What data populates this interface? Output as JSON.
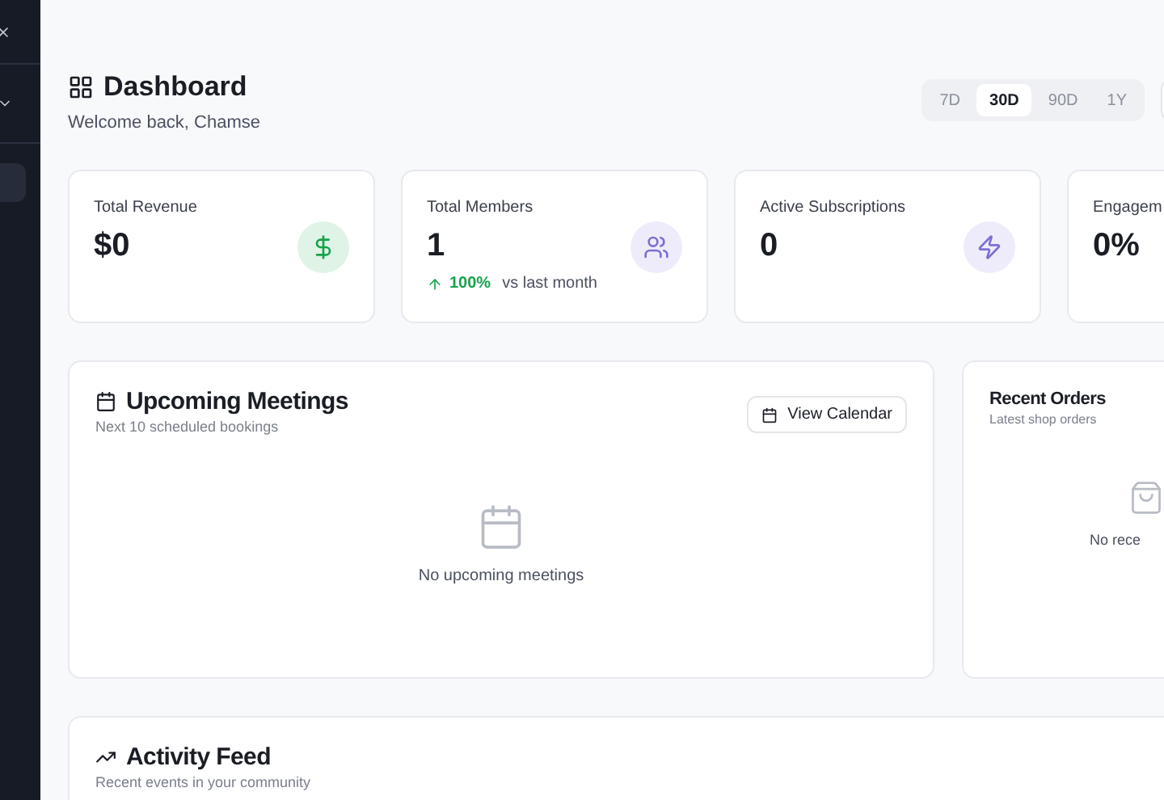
{
  "sidebar": {
    "items": [
      {
        "kind": "close"
      },
      {
        "kind": "dropdown"
      },
      {
        "kind": "item",
        "selected": true
      }
    ]
  },
  "header": {
    "title": "Dashboard",
    "subtitle": "Welcome back, Chamse"
  },
  "ranges": [
    {
      "label": "7D",
      "selected": false
    },
    {
      "label": "30D",
      "selected": true
    },
    {
      "label": "90D",
      "selected": false
    },
    {
      "label": "1Y",
      "selected": false
    }
  ],
  "stats": [
    {
      "label": "Total Revenue",
      "value": "$0",
      "color": "#16a34a"
    },
    {
      "label": "Total Members",
      "value": "1",
      "color": "#7c6fd6",
      "change": "100%",
      "change_note": "vs last month"
    },
    {
      "label": "Active Subscriptions",
      "value": "0",
      "color": "#7c6fd6"
    },
    {
      "label": "Engagem",
      "value": "0%"
    }
  ],
  "meetings": {
    "title": "Upcoming Meetings",
    "subtitle": "Next 10 scheduled bookings",
    "button": "View Calendar",
    "empty": "No upcoming meetings"
  },
  "orders": {
    "title": "Recent Orders",
    "subtitle": "Latest shop orders",
    "empty": "No rece"
  },
  "activity": {
    "title": "Activity Feed",
    "subtitle": "Recent events in your community"
  }
}
